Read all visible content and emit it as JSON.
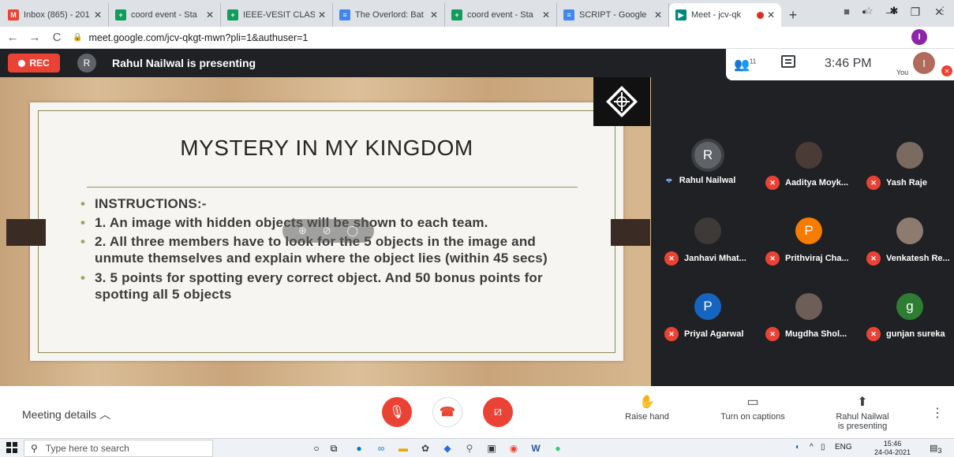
{
  "browser": {
    "tabs": [
      {
        "title": "Inbox (865) - 201",
        "favicon": "gmail-icon",
        "color": "#ea4335",
        "glyph": "M"
      },
      {
        "title": "coord event - Sta",
        "favicon": "sheets-icon",
        "color": "#0f9d58",
        "glyph": "+"
      },
      {
        "title": "IEEE-VESIT CLASH",
        "favicon": "sheets-icon",
        "color": "#0f9d58",
        "glyph": "+"
      },
      {
        "title": "The Overlord: Bat",
        "favicon": "docs-icon",
        "color": "#4285f4",
        "glyph": "≡"
      },
      {
        "title": "coord event - Sta",
        "favicon": "sheets-icon",
        "color": "#0f9d58",
        "glyph": "+"
      },
      {
        "title": "SCRIPT - Google",
        "favicon": "docs-icon",
        "color": "#4285f4",
        "glyph": "≡"
      },
      {
        "title": "Meet - jcv-qk",
        "favicon": "meet-icon",
        "color": "#00897b",
        "glyph": "▶"
      }
    ],
    "url": "meet.google.com/jcv-qkgt-mwn?pli=1&authuser=1",
    "profile_initial": "I"
  },
  "meet": {
    "rec_label": "REC",
    "presenter_initial": "R",
    "presenting_text": "Rahul Nailwal is presenting",
    "people_count": "11",
    "time": "3:46 PM",
    "you_label": "You",
    "you_initial": "I"
  },
  "slide": {
    "title": "MYSTERY IN MY KINGDOM",
    "bullets": [
      "INSTRUCTIONS:-",
      "1. An image with hidden objects will be shown to each team.",
      "2. All three members have to look for the 5 objects in the image and unmute themselves and explain where the object lies (within 45 secs)",
      "3. 5 points for spotting every correct object. And 50 bonus points for spotting all 5 objects"
    ]
  },
  "participants": [
    {
      "name": "Rahul Nailwal",
      "initial": "R",
      "color": "#5f6368",
      "speaking": true
    },
    {
      "name": "Aaditya Moyk...",
      "initial": "",
      "color": "#4a3b36",
      "speaking": false
    },
    {
      "name": "Yash Raje",
      "initial": "",
      "color": "#7a6a60",
      "speaking": false
    },
    {
      "name": "Janhavi Mhat...",
      "initial": "",
      "color": "#3d3a38",
      "speaking": false
    },
    {
      "name": "Prithviraj Cha...",
      "initial": "P",
      "color": "#f57c00",
      "speaking": false
    },
    {
      "name": "Venkatesh Re...",
      "initial": "",
      "color": "#8d7b70",
      "speaking": false
    },
    {
      "name": "Priyal Agarwal",
      "initial": "P",
      "color": "#1565c0",
      "speaking": false
    },
    {
      "name": "Mugdha Shol...",
      "initial": "",
      "color": "#6d5e57",
      "speaking": false
    },
    {
      "name": "gunjan sureka",
      "initial": "g",
      "color": "#2e7d32",
      "speaking": false
    }
  ],
  "controls": {
    "meeting_details": "Meeting details",
    "raise_hand": "Raise hand",
    "captions": "Turn on captions",
    "presenting_line1": "Rahul Nailwal",
    "presenting_line2": "is presenting"
  },
  "taskbar": {
    "search_placeholder": "Type here to search",
    "lang": "ENG",
    "time": "15:46",
    "date": "24-04-2021",
    "notifications": "3"
  }
}
